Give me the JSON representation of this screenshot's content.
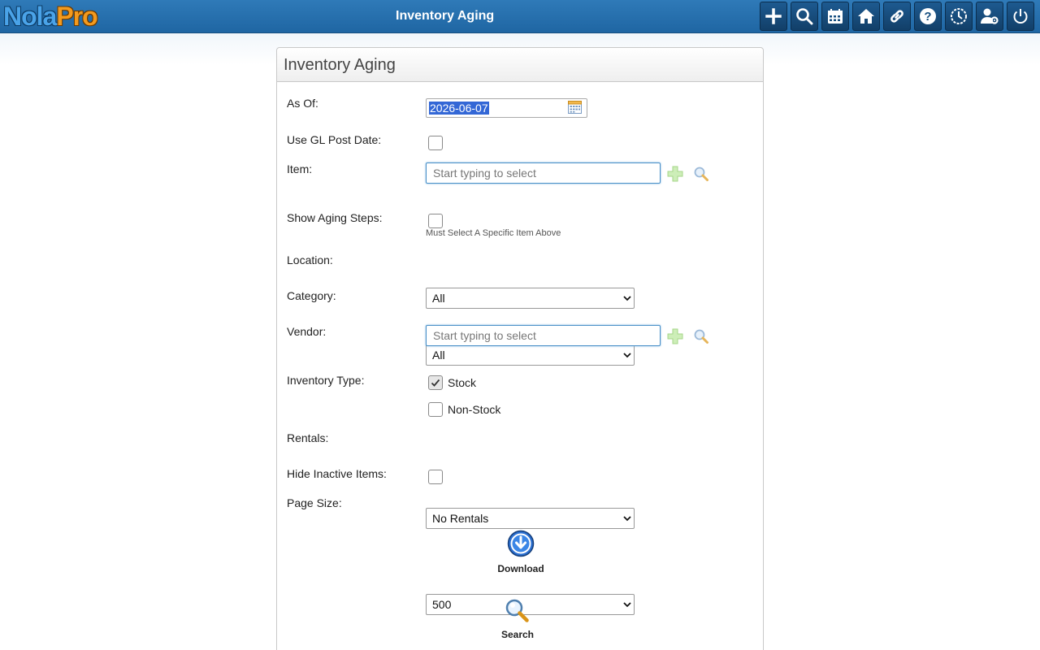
{
  "app": {
    "logo_part1": "Nola",
    "logo_part2": "Pro",
    "page_title": "Inventory Aging"
  },
  "toolbar": {
    "icons": [
      "plus-icon",
      "search-icon",
      "calendar-icon",
      "home-icon",
      "link-icon",
      "help-icon",
      "clock-icon",
      "user-settings-icon",
      "power-icon"
    ]
  },
  "panel": {
    "title": "Inventory Aging"
  },
  "form": {
    "as_of": {
      "label": "As Of:",
      "value": "2026-06-07"
    },
    "use_gl_post_date": {
      "label": "Use GL Post Date:",
      "checked": false
    },
    "item": {
      "label": "Item:",
      "placeholder": "Start typing to select"
    },
    "show_aging_steps": {
      "label": "Show Aging Steps:",
      "checked": false,
      "hint": "Must Select A Specific Item Above"
    },
    "location": {
      "label": "Location:",
      "selected": "All"
    },
    "category": {
      "label": "Category:",
      "selected": "All"
    },
    "vendor": {
      "label": "Vendor:",
      "placeholder": "Start typing to select"
    },
    "inventory_type": {
      "label": "Inventory Type:",
      "options": [
        {
          "label": "Stock",
          "checked": true
        },
        {
          "label": "Non-Stock",
          "checked": false
        }
      ]
    },
    "rentals": {
      "label": "Rentals:",
      "selected": "No Rentals"
    },
    "hide_inactive": {
      "label": "Hide Inactive Items:",
      "checked": false
    },
    "page_size": {
      "label": "Page Size:",
      "selected": "500"
    }
  },
  "actions": {
    "download_label": "Download",
    "search_label": "Search"
  },
  "colors": {
    "topbar": "#1f66a3",
    "accent_blue": "#4a90c8",
    "selection": "#3367d6"
  }
}
